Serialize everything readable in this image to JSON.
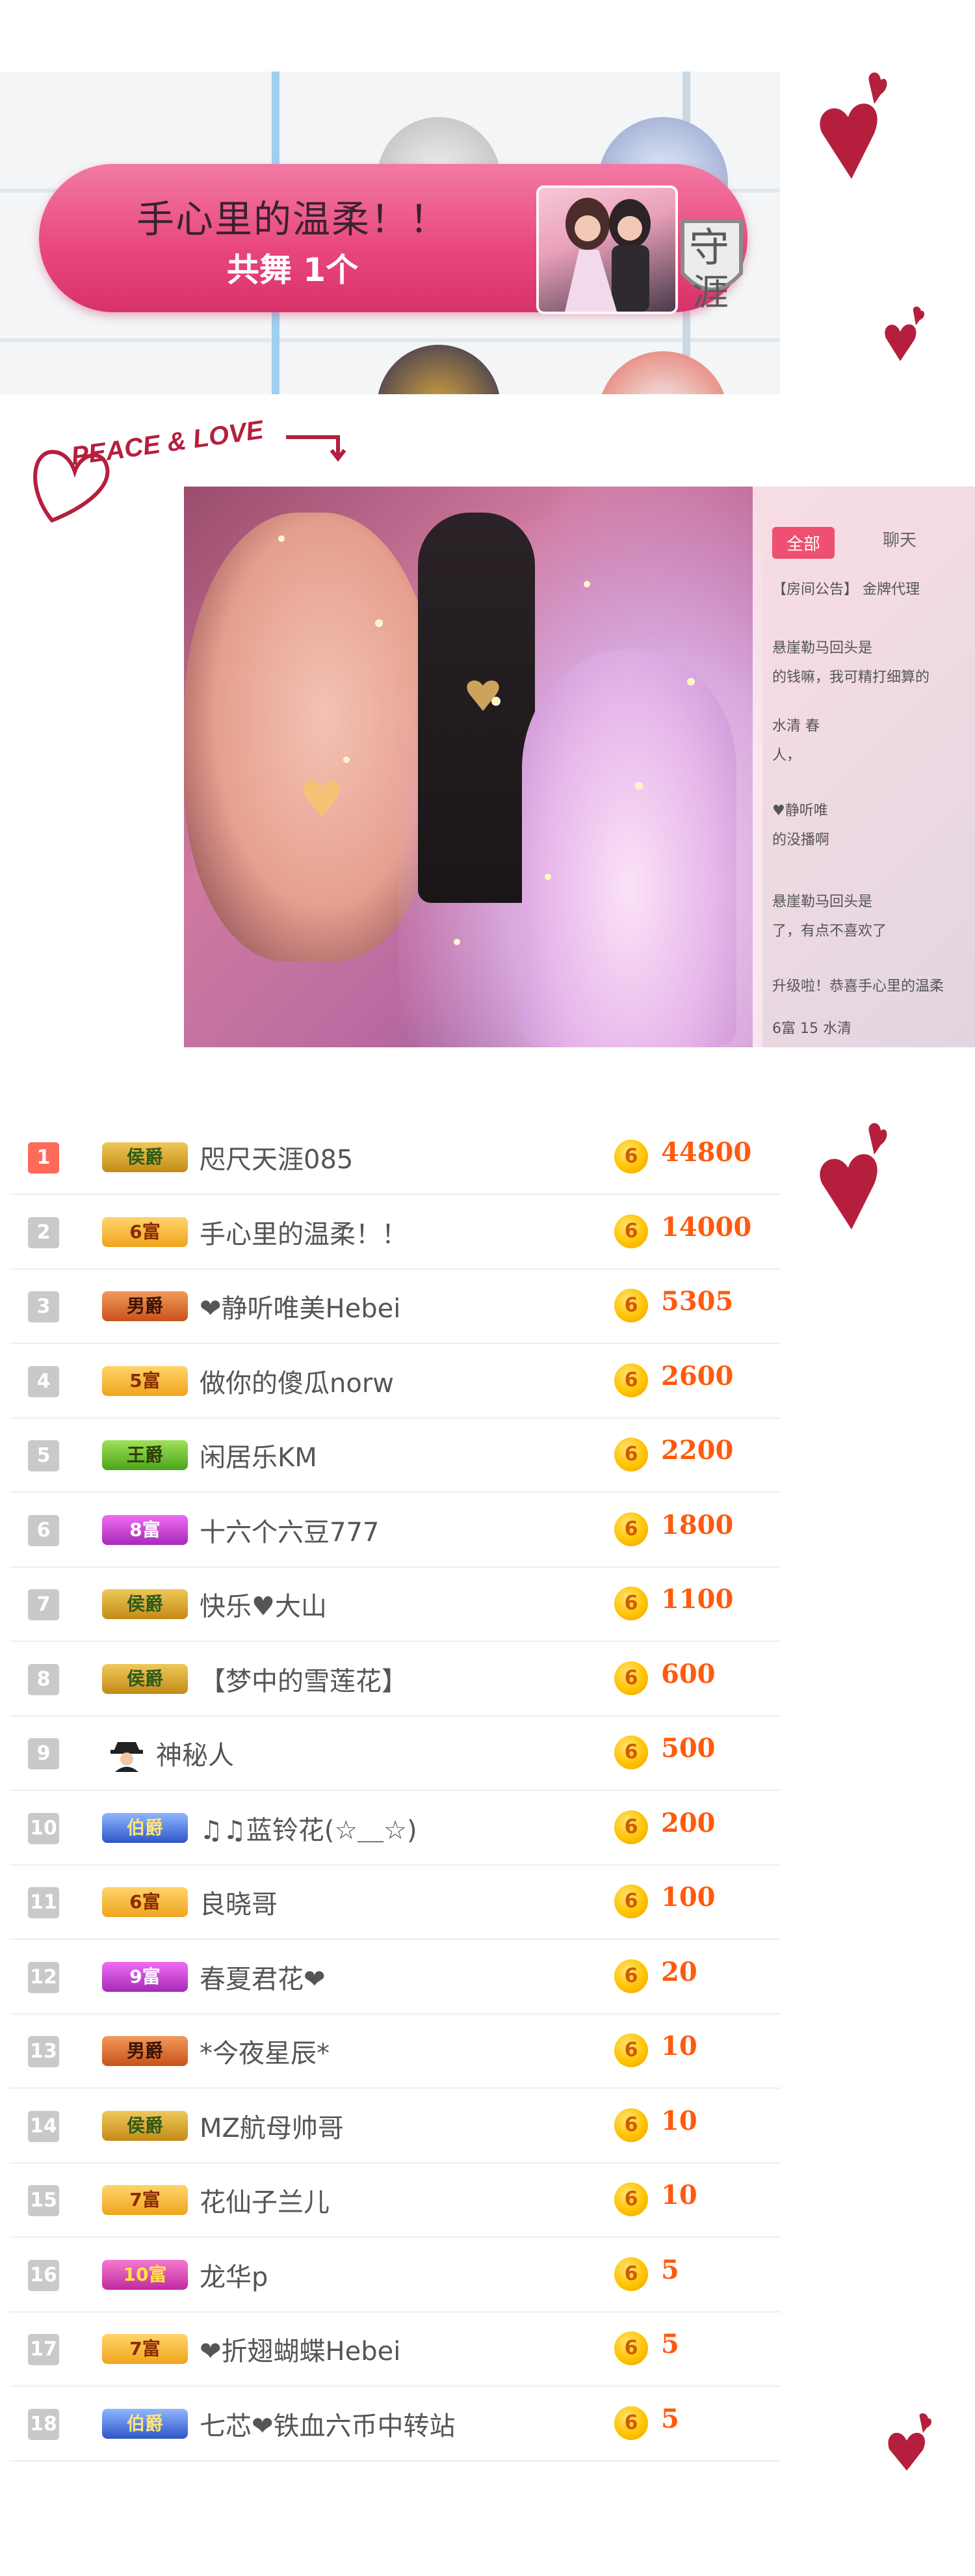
{
  "banner": {
    "user": "手心里的温柔！！",
    "count_text": "共舞 1个",
    "guard_char": "守",
    "guard_char2": "涯"
  },
  "peace_love": "PEACE & LOVE",
  "photo": {
    "chat_tabs": [
      "全部",
      "聊天"
    ],
    "chat_lines": [
      {
        "text": "【房间公告】  金牌代理"
      },
      {
        "text": "悬崖勒马回头是"
      },
      {
        "text": "的钱嘛，我可精打细算的"
      },
      {
        "text": "水清  春"
      },
      {
        "text": "人，"
      },
      {
        "text": "♥静听唯"
      },
      {
        "text": "的没播啊"
      },
      {
        "text": "悬崖勒马回头是"
      },
      {
        "text": "了，有点不喜欢了"
      },
      {
        "text": "升级啦！恭喜手心里的温柔"
      },
      {
        "text": "6富  15 水清"
      }
    ]
  },
  "leaderboard": [
    {
      "rank": "1",
      "badge": "侯爵",
      "badge_type": "hou",
      "name": "咫尺天涯085",
      "amount": "44800"
    },
    {
      "rank": "2",
      "badge": "6富",
      "badge_type": "gong",
      "name": "手心里的温柔！！",
      "amount": "14000"
    },
    {
      "rank": "3",
      "badge": "男爵",
      "badge_type": "nan",
      "name": "❤静听唯美Hebei",
      "amount": "5305"
    },
    {
      "rank": "4",
      "badge": "5富",
      "badge_type": "gong",
      "name": "做你的傻瓜norw",
      "amount": "2600"
    },
    {
      "rank": "5",
      "badge": "王爵",
      "badge_type": "wang",
      "name": "闲居乐KM",
      "amount": "2200"
    },
    {
      "rank": "6",
      "badge": "8富",
      "badge_type": "purple",
      "name": "十六个六豆777",
      "amount": "1800"
    },
    {
      "rank": "7",
      "badge": "侯爵",
      "badge_type": "hou",
      "name": "快乐♥大山",
      "amount": "1100"
    },
    {
      "rank": "8",
      "badge": "侯爵",
      "badge_type": "hou",
      "name": "【梦中的雪莲花】",
      "amount": "600"
    },
    {
      "rank": "9",
      "badge": "",
      "badge_type": "mystery",
      "name": "神秘人",
      "amount": "500"
    },
    {
      "rank": "10",
      "badge": "伯爵",
      "badge_type": "bo",
      "name": "♫♫蓝铃花(☆＿☆)",
      "amount": "200"
    },
    {
      "rank": "11",
      "badge": "6富",
      "badge_type": "gong",
      "name": "良晓哥",
      "amount": "100"
    },
    {
      "rank": "12",
      "badge": "9富",
      "badge_type": "purple",
      "name": "春夏君花❤",
      "amount": "20"
    },
    {
      "rank": "13",
      "badge": "男爵",
      "badge_type": "nan",
      "name": "*今夜星辰*",
      "amount": "10"
    },
    {
      "rank": "14",
      "badge": "侯爵",
      "badge_type": "hou",
      "name": "MZ航母帅哥",
      "amount": "10"
    },
    {
      "rank": "15",
      "badge": "7富",
      "badge_type": "gong",
      "name": "花仙子兰儿",
      "amount": "10"
    },
    {
      "rank": "16",
      "badge": "10富",
      "badge_type": "ten",
      "name": "龙华p",
      "amount": "5"
    },
    {
      "rank": "17",
      "badge": "7富",
      "badge_type": "gong",
      "name": "❤折翅蝴蝶Hebei",
      "amount": "5"
    },
    {
      "rank": "18",
      "badge": "伯爵",
      "badge_type": "bo",
      "name": "七芯❤铁血六币中转站",
      "amount": "5"
    }
  ],
  "coin_glyph": "6",
  "mystery_icon": "spy-icon"
}
